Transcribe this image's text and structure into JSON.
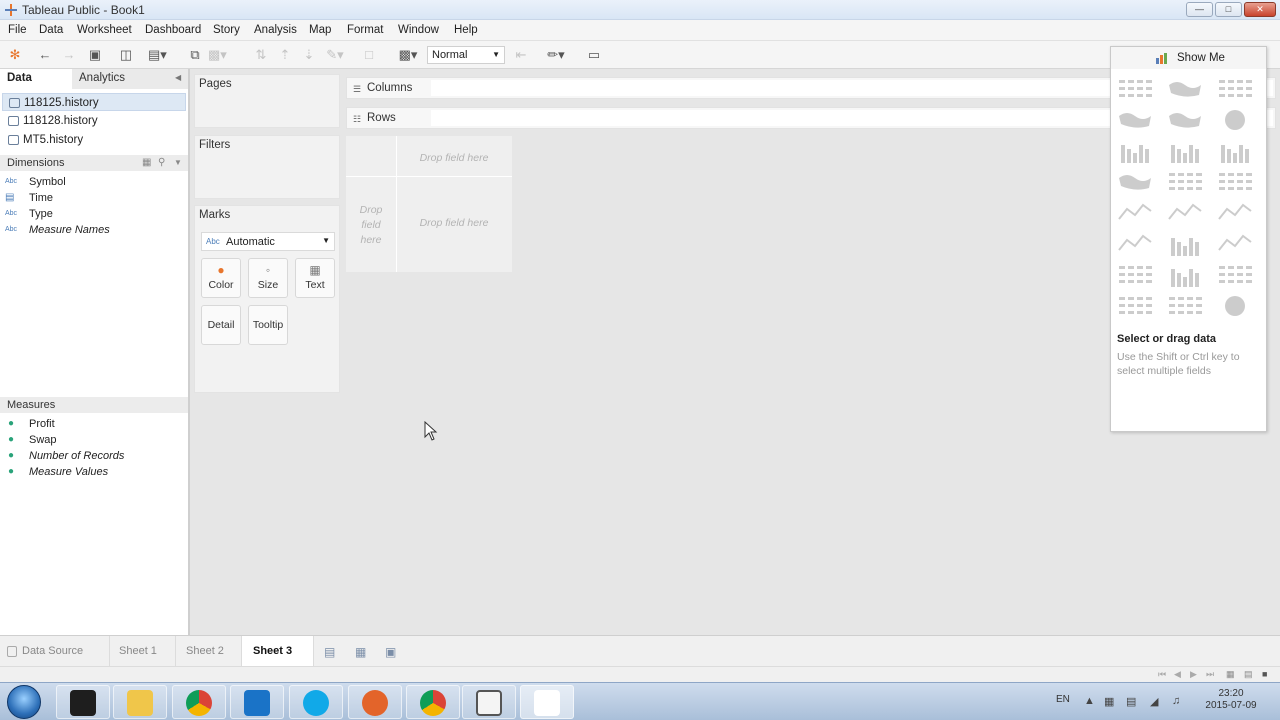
{
  "window": {
    "title": "Tableau Public - Book1"
  },
  "menu": [
    "File",
    "Data",
    "Worksheet",
    "Dashboard",
    "Story",
    "Analysis",
    "Map",
    "Format",
    "Window",
    "Help"
  ],
  "toolbar": {
    "fit_mode": "Normal"
  },
  "leftpane": {
    "tabs": {
      "data": "Data",
      "analytics": "Analytics"
    },
    "datasources": [
      "118125.history",
      "118128.history",
      "MT5.history"
    ],
    "dimensions_header": "Dimensions",
    "dimensions": [
      {
        "type": "Abc",
        "label": "Symbol",
        "italic": false
      },
      {
        "type": "cal",
        "label": "Time",
        "italic": false
      },
      {
        "type": "Abc",
        "label": "Type",
        "italic": false
      },
      {
        "type": "Abc",
        "label": "Measure Names",
        "italic": true
      }
    ],
    "measures_header": "Measures",
    "measures": [
      {
        "label": "Profit",
        "italic": false
      },
      {
        "label": "Swap",
        "italic": false
      },
      {
        "label": "Number of Records",
        "italic": true
      },
      {
        "label": "Measure Values",
        "italic": true
      }
    ]
  },
  "cards": {
    "pages": "Pages",
    "filters": "Filters",
    "marks": "Marks",
    "mark_type": "Automatic",
    "mark_type_icon": "Abc",
    "buttons": {
      "color": "Color",
      "size": "Size",
      "text": "Text",
      "detail": "Detail",
      "tooltip": "Tooltip"
    }
  },
  "shelves": {
    "columns": "Columns",
    "rows": "Rows"
  },
  "dropzone": {
    "top": "Drop field here",
    "main": "Drop field here",
    "left": "Drop field here"
  },
  "showme": {
    "title": "Show Me",
    "hint_title": "Select or drag data",
    "hint_body": "Use the Shift or Ctrl key to select multiple fields"
  },
  "sheets": {
    "datasource": "Data Source",
    "tabs": [
      "Sheet 1",
      "Sheet 2",
      "Sheet 3"
    ],
    "active_index": 2
  },
  "taskbar": {
    "lang": "EN",
    "time": "23:20",
    "date": "2015-07-09"
  },
  "colors": {
    "accent": "#4b7db8",
    "measure": "#2aa37a",
    "taskbar": "#b8cbe2"
  }
}
